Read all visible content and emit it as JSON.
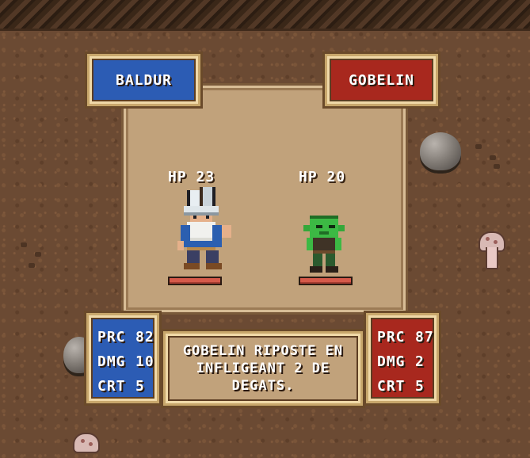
{
  "player": {
    "name": "BALDUR",
    "hp_label": "HP 23",
    "hp_fraction": 1.0,
    "stats": [
      {
        "key": "PRC",
        "value": "82"
      },
      {
        "key": "DMG",
        "value": "10"
      },
      {
        "key": "CRT",
        "value": "5"
      }
    ]
  },
  "enemy": {
    "name": "GOBELIN",
    "hp_label": "HP 20",
    "hp_fraction": 1.0,
    "stats": [
      {
        "key": "PRC",
        "value": "87"
      },
      {
        "key": "DMG",
        "value": "2"
      },
      {
        "key": "CRT",
        "value": "5"
      }
    ]
  },
  "message": "GOBELIN RIPOSTE EN INFLIGEANT 2 DE DEGATS.",
  "colors": {
    "player_panel": "#2c5cb4",
    "enemy_panel": "#a8281e",
    "hp_fill": "#d65a4a",
    "arena": "#c1a27b"
  }
}
